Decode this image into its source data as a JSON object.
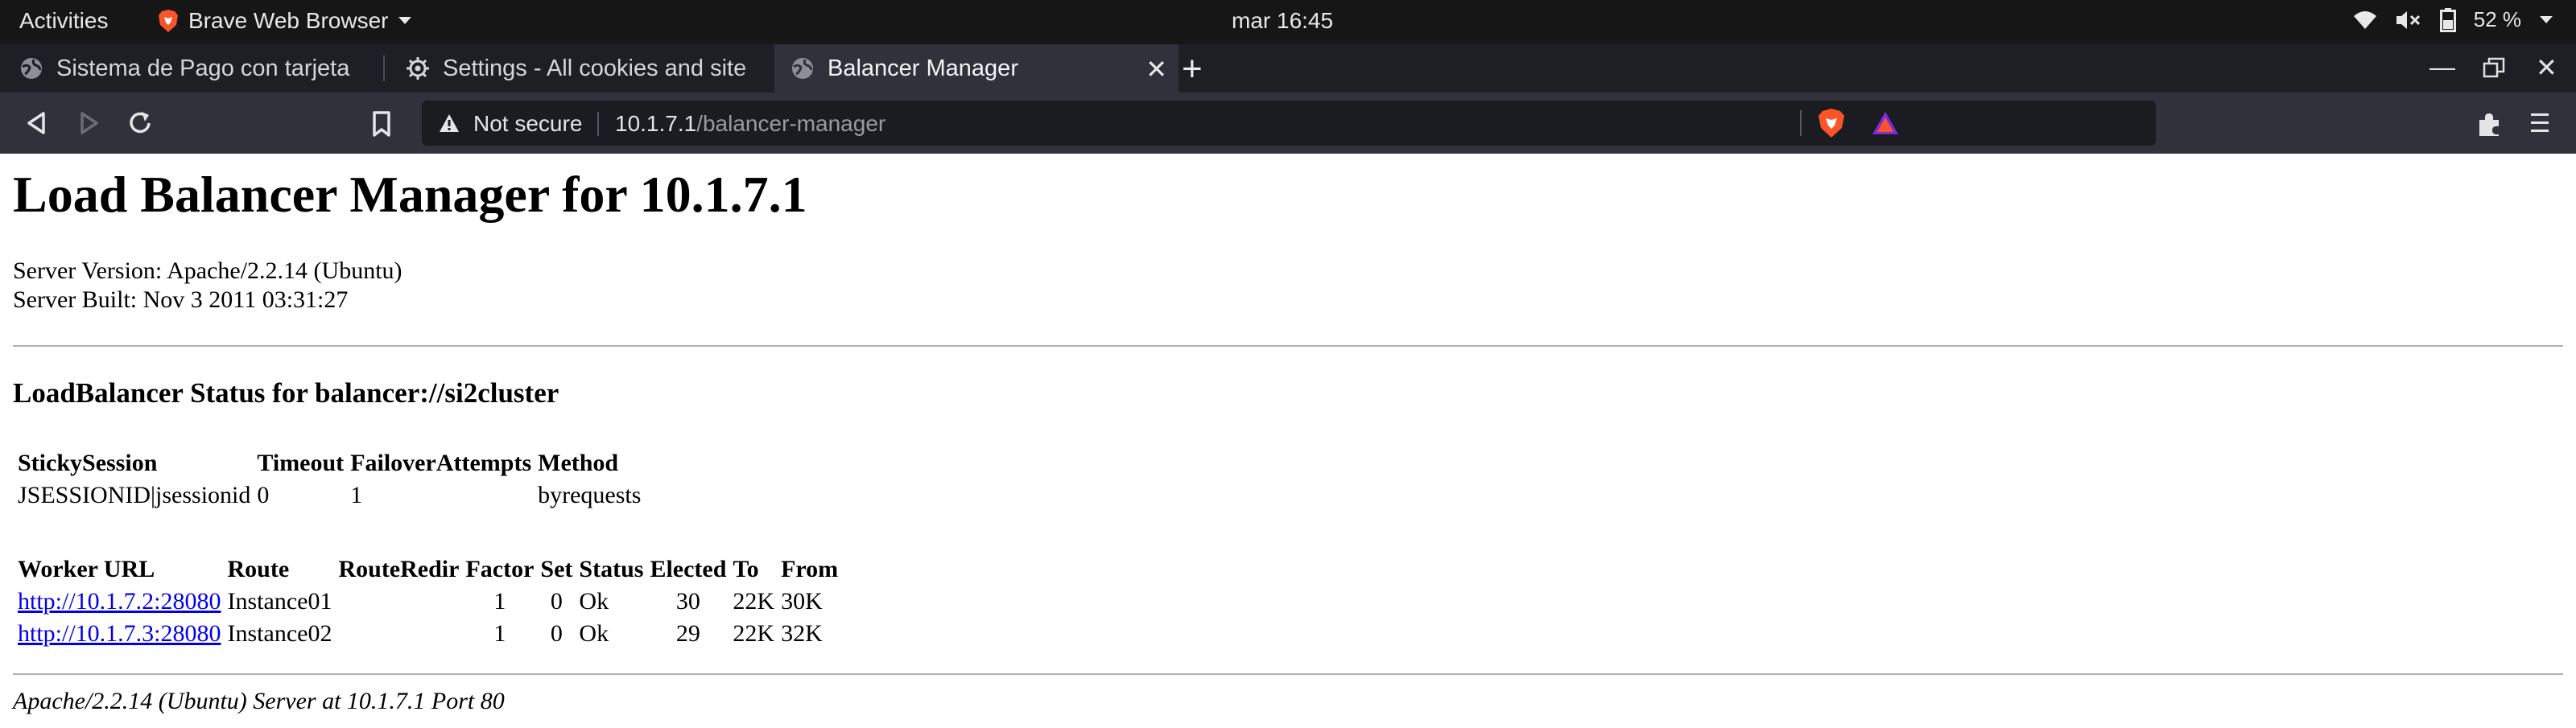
{
  "system_bar": {
    "activities": "Activities",
    "app_name": "Brave Web Browser",
    "clock": "mar 16:45",
    "battery_percent": "52 %",
    "icons": [
      "wifi-icon",
      "volume-muted-icon",
      "battery-icon",
      "chevron-down-icon"
    ]
  },
  "browser": {
    "tabs": [
      {
        "title": "Sistema de Pago con tarjeta",
        "icon": "globe-icon",
        "active": false
      },
      {
        "title": "Settings - All cookies and site",
        "icon": "gear-icon",
        "active": false
      },
      {
        "title": "Balancer Manager",
        "icon": "globe-icon",
        "active": true
      }
    ],
    "address": {
      "security_label": "Not secure",
      "url_host": "10.1.7.1",
      "url_path": "/balancer-manager"
    },
    "toolbar_icons": [
      "back-icon",
      "forward-icon",
      "reload-icon",
      "bookmark-icon",
      "brave-shields-icon",
      "brave-rewards-icon",
      "extensions-icon",
      "menu-icon"
    ],
    "colors": {
      "tabstrip": "#1e1f25",
      "toolbar": "#30313a",
      "omnibox": "#1b1c21",
      "brave_orange": "#fb542b"
    }
  },
  "page": {
    "title": "Load Balancer Manager for 10.1.7.1",
    "server_version": "Server Version: Apache/2.2.14 (Ubuntu)",
    "server_built": "Server Built: Nov 3 2011 03:31:27",
    "status_heading": "LoadBalancer Status for balancer://si2cluster",
    "balancer_table": {
      "headers": [
        "StickySession",
        "Timeout",
        "FailoverAttempts",
        "Method"
      ],
      "row": [
        "JSESSIONID|jsessionid",
        "0",
        "1",
        "byrequests"
      ]
    },
    "worker_table": {
      "headers": [
        "Worker URL",
        "Route",
        "RouteRedir",
        "Factor",
        "Set",
        "Status",
        "Elected",
        "To",
        "From"
      ],
      "rows": [
        [
          "http://10.1.7.2:28080",
          "Instance01",
          "",
          "1",
          "0",
          "Ok",
          "30",
          "22K",
          "30K"
        ],
        [
          "http://10.1.7.3:28080",
          "Instance02",
          "",
          "1",
          "0",
          "Ok",
          "29",
          "22K",
          "32K"
        ]
      ]
    },
    "footer": "Apache/2.2.14 (Ubuntu) Server at 10.1.7.1 Port 80"
  }
}
